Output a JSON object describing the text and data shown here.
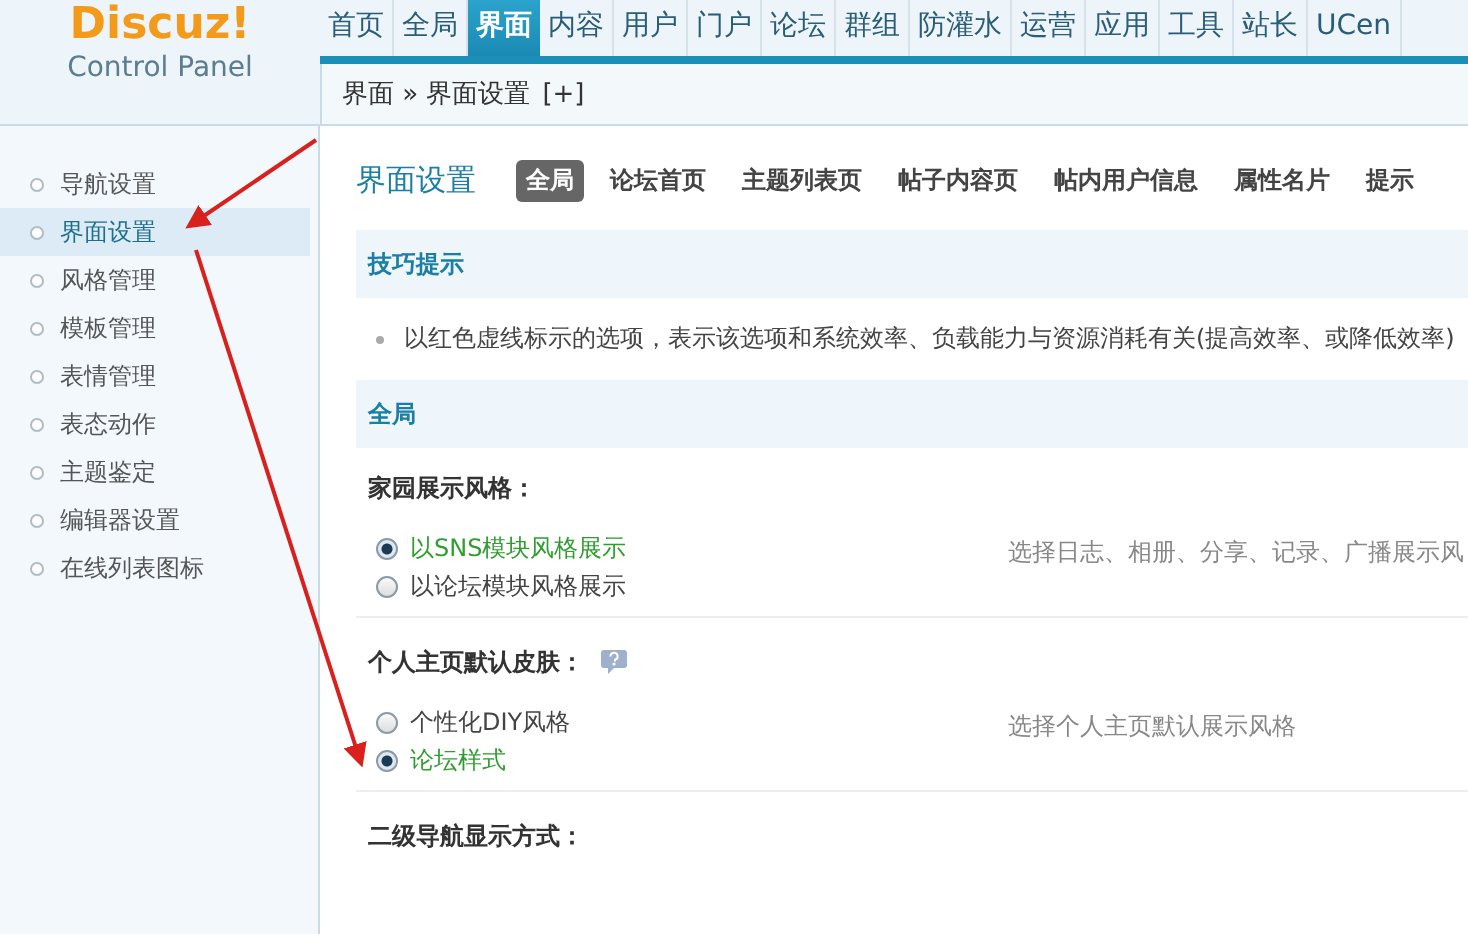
{
  "logo": {
    "title": "Discuz!",
    "subtitle": "Control Panel"
  },
  "nav": [
    {
      "label": "首页",
      "selected": false
    },
    {
      "label": "全局",
      "selected": false
    },
    {
      "label": "界面",
      "selected": true
    },
    {
      "label": "内容",
      "selected": false
    },
    {
      "label": "用户",
      "selected": false
    },
    {
      "label": "门户",
      "selected": false
    },
    {
      "label": "论坛",
      "selected": false
    },
    {
      "label": "群组",
      "selected": false
    },
    {
      "label": "防灌水",
      "selected": false
    },
    {
      "label": "运营",
      "selected": false
    },
    {
      "label": "应用",
      "selected": false
    },
    {
      "label": "工具",
      "selected": false
    },
    {
      "label": "站长",
      "selected": false
    },
    {
      "label": "UCen",
      "selected": false
    }
  ],
  "breadcrumb": {
    "path": "界面 » 界面设置",
    "add": "[+]"
  },
  "sidebar": {
    "items": [
      {
        "label": "导航设置",
        "selected": false
      },
      {
        "label": "界面设置",
        "selected": true
      },
      {
        "label": "风格管理",
        "selected": false
      },
      {
        "label": "模板管理",
        "selected": false
      },
      {
        "label": "表情管理",
        "selected": false
      },
      {
        "label": "表态动作",
        "selected": false
      },
      {
        "label": "主题鉴定",
        "selected": false
      },
      {
        "label": "编辑器设置",
        "selected": false
      },
      {
        "label": "在线列表图标",
        "selected": false
      }
    ]
  },
  "page": {
    "title": "界面设置",
    "tabs": [
      {
        "label": "全局",
        "selected": true
      },
      {
        "label": "论坛首页",
        "selected": false
      },
      {
        "label": "主题列表页",
        "selected": false
      },
      {
        "label": "帖子内容页",
        "selected": false
      },
      {
        "label": "帖内用户信息",
        "selected": false
      },
      {
        "label": "属性名片",
        "selected": false
      },
      {
        "label": "提示",
        "selected": false
      }
    ]
  },
  "tips": {
    "title": "技巧提示",
    "items": [
      "以红色虚线标示的选项，表示该选项和系统效率、负载能力与资源消耗有关(提高效率、或降低效率)"
    ]
  },
  "section": {
    "title": "全局",
    "settings": [
      {
        "label": "家园展示风格：",
        "description": "选择日志、相册、分享、记录、广播展示风",
        "options": [
          {
            "label": "以SNS模块风格展示",
            "selected": true
          },
          {
            "label": "以论坛模块风格展示",
            "selected": false
          }
        ]
      },
      {
        "label": "个人主页默认皮肤：",
        "help": true,
        "description": "选择个人主页默认展示风格",
        "options": [
          {
            "label": "个性化DIY风格",
            "selected": false
          },
          {
            "label": "论坛样式",
            "selected": true
          }
        ]
      },
      {
        "label": "二级导航显示方式："
      }
    ]
  }
}
